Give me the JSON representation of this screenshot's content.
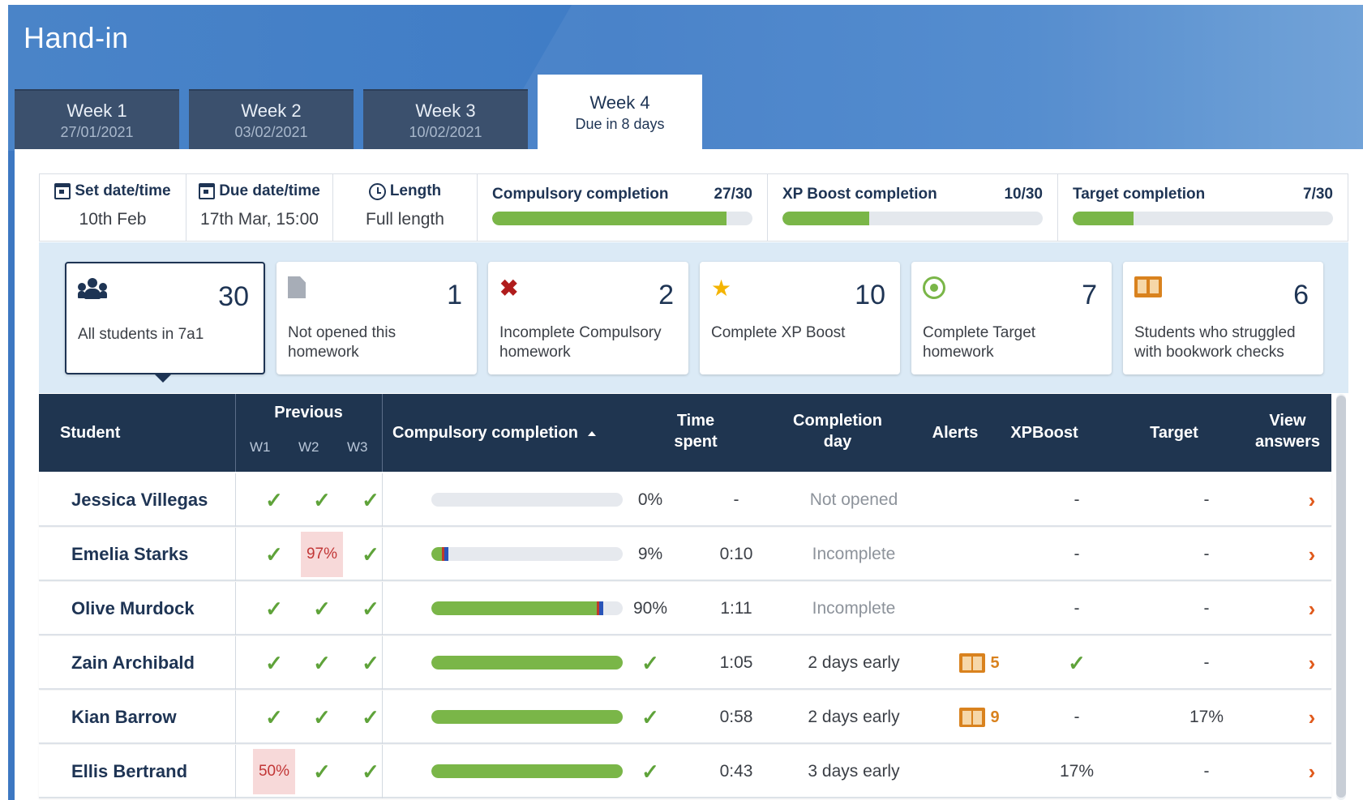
{
  "page": {
    "title": "Hand-in"
  },
  "weeks": [
    {
      "label": "Week 1",
      "date": "27/01/2021"
    },
    {
      "label": "Week 2",
      "date": "03/02/2021"
    },
    {
      "label": "Week 3",
      "date": "10/02/2021"
    },
    {
      "label": "Week 4",
      "date": "Due in 8 days"
    }
  ],
  "info": {
    "set": {
      "label": "Set date/time",
      "value": "10th Feb"
    },
    "due": {
      "label": "Due date/time",
      "value": "17th Mar, 15:00"
    },
    "length": {
      "label": "Length",
      "value": "Full length"
    }
  },
  "progress": [
    {
      "label": "Compulsory completion",
      "value": "27/30",
      "fraction": 0.9
    },
    {
      "label": "XP Boost completion",
      "value": "10/30",
      "fraction": 0.333
    },
    {
      "label": "Target completion",
      "value": "7/30",
      "fraction": 0.233
    }
  ],
  "filters": [
    {
      "count": "30",
      "label": "All students in 7a1",
      "icon": "users-icon"
    },
    {
      "count": "1",
      "label": "Not opened this homework",
      "icon": "document-icon"
    },
    {
      "count": "2",
      "label": "Incomplete Compulsory homework",
      "icon": "cross-icon"
    },
    {
      "count": "10",
      "label": "Complete XP Boost",
      "icon": "star-icon"
    },
    {
      "count": "7",
      "label": "Complete Target homework",
      "icon": "target-icon"
    },
    {
      "count": "6",
      "label": "Students who struggled with bookwork checks",
      "icon": "book-icon"
    }
  ],
  "table": {
    "headers": {
      "student": "Student",
      "previous": "Previous",
      "w1": "W1",
      "w2": "W2",
      "w3": "W3",
      "compulsory": "Compulsory completion",
      "time_1": "Time",
      "time_2": "spent",
      "day_1": "Completion",
      "day_2": "day",
      "alerts": "Alerts",
      "xpboost": "XPBoost",
      "target": "Target",
      "view_1": "View",
      "view_2": "answers"
    },
    "rows": [
      {
        "name": "Jessica Villegas",
        "prev": [
          "check",
          "check",
          "check"
        ],
        "progress": 0,
        "completion": "0%",
        "time": "-",
        "day": "Not opened",
        "day_muted": true,
        "alert": "",
        "xp": "-",
        "target": "-"
      },
      {
        "name": "Emelia Starks",
        "prev": [
          "check",
          "97%",
          "check"
        ],
        "progress": 0.09,
        "completion": "9%",
        "time": "0:10",
        "day": "Incomplete",
        "day_muted": true,
        "alert": "",
        "xp": "-",
        "target": "-"
      },
      {
        "name": "Olive Murdock",
        "prev": [
          "check",
          "check",
          "check"
        ],
        "progress": 0.9,
        "completion": "90%",
        "time": "1:11",
        "day": "Incomplete",
        "day_muted": true,
        "alert": "",
        "xp": "-",
        "target": "-"
      },
      {
        "name": "Zain Archibald",
        "prev": [
          "check",
          "check",
          "check"
        ],
        "progress": 1,
        "completion": "check",
        "time": "1:05",
        "day": "2 days early",
        "day_muted": false,
        "alert": "5",
        "xp": "check",
        "target": "-"
      },
      {
        "name": "Kian Barrow",
        "prev": [
          "check",
          "check",
          "check"
        ],
        "progress": 1,
        "completion": "check",
        "time": "0:58",
        "day": "2 days early",
        "day_muted": false,
        "alert": "9",
        "xp": "-",
        "target": "17%"
      },
      {
        "name": "Ellis Bertrand",
        "prev": [
          "50%",
          "check",
          "check"
        ],
        "progress": 1,
        "completion": "check",
        "time": "0:43",
        "day": "3 days early",
        "day_muted": false,
        "alert": "",
        "xp": "17%",
        "target": "-"
      }
    ]
  },
  "colors": {
    "header": "#1f3550",
    "accent_green": "#7ab648",
    "alert_orange": "#d9821e",
    "chevron": "#e05a1c"
  }
}
